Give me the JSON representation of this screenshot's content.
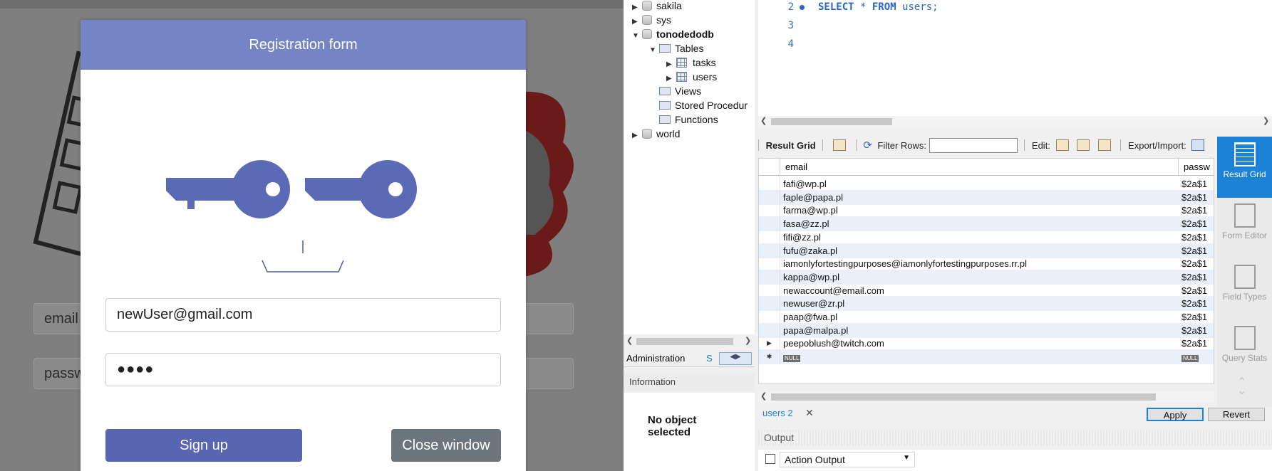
{
  "modal": {
    "title": "Registration form",
    "email_value": "newUser@gmail.com",
    "password_value": "●●●●",
    "signup_label": "Sign up",
    "close_label": "Close window"
  },
  "background_form": {
    "email_placeholder": "email",
    "password_placeholder": "passw"
  },
  "colors": {
    "modal_header": "#7584c4",
    "key_blue": "#5b6ab5",
    "signup_button": "#5865b0",
    "close_button": "#6c757d",
    "workbench_accent": "#1b82d6"
  },
  "navigator": {
    "schemas": [
      {
        "name": "sakila",
        "expanded": false
      },
      {
        "name": "sys",
        "expanded": false
      },
      {
        "name": "tonodedodb",
        "expanded": true
      },
      {
        "name": "world",
        "expanded": false
      }
    ],
    "folders": [
      "Tables",
      "Views",
      "Stored Procedur",
      "Functions"
    ],
    "tables": [
      "tasks",
      "users"
    ],
    "tab_administration": "Administration",
    "tab_schemas": "S",
    "info_title": "Information",
    "no_object": "No object selected"
  },
  "editor": {
    "line_numbers": [
      "2",
      "3",
      "4"
    ],
    "sql_keyword1": "SELECT",
    "sql_rest1": " * ",
    "sql_keyword2": "FROM",
    "sql_rest2": " users;"
  },
  "result_toolbar": {
    "result_grid": "Result Grid",
    "filter_rows": "Filter Rows:",
    "edit": "Edit:",
    "export_import": "Export/Import:"
  },
  "grid": {
    "columns": [
      "email",
      "passw"
    ],
    "rows": [
      {
        "email": "fafi@wp.pl",
        "password": "$2a$1"
      },
      {
        "email": "faple@papa.pl",
        "password": "$2a$1"
      },
      {
        "email": "farma@wp.pl",
        "password": "$2a$1"
      },
      {
        "email": "fasa@zz.pl",
        "password": "$2a$1"
      },
      {
        "email": "fifi@zz.pl",
        "password": "$2a$1"
      },
      {
        "email": "fufu@zaka.pl",
        "password": "$2a$1"
      },
      {
        "email": "iamonlyfortestingpurposes@iamonlyfortestingpurposes.rr.pl",
        "password": "$2a$1"
      },
      {
        "email": "kappa@wp.pl",
        "password": "$2a$1"
      },
      {
        "email": "newaccount@email.com",
        "password": "$2a$1"
      },
      {
        "email": "newuser@zr.pl",
        "password": "$2a$1"
      },
      {
        "email": "paap@fwa.pl",
        "password": "$2a$1"
      },
      {
        "email": "papa@malpa.pl",
        "password": "$2a$1"
      },
      {
        "email": "peepoblush@twitch.com",
        "password": "$2a$1"
      }
    ],
    "null_label": "NULL"
  },
  "side_panel": {
    "result_grid": "Result Grid",
    "form_editor": "Form Editor",
    "field_types": "Field Types",
    "query_stats": "Query Stats"
  },
  "results_tab": {
    "name": "users 2",
    "apply": "Apply",
    "revert": "Revert"
  },
  "output": {
    "title": "Output",
    "dropdown_value": "Action Output"
  }
}
